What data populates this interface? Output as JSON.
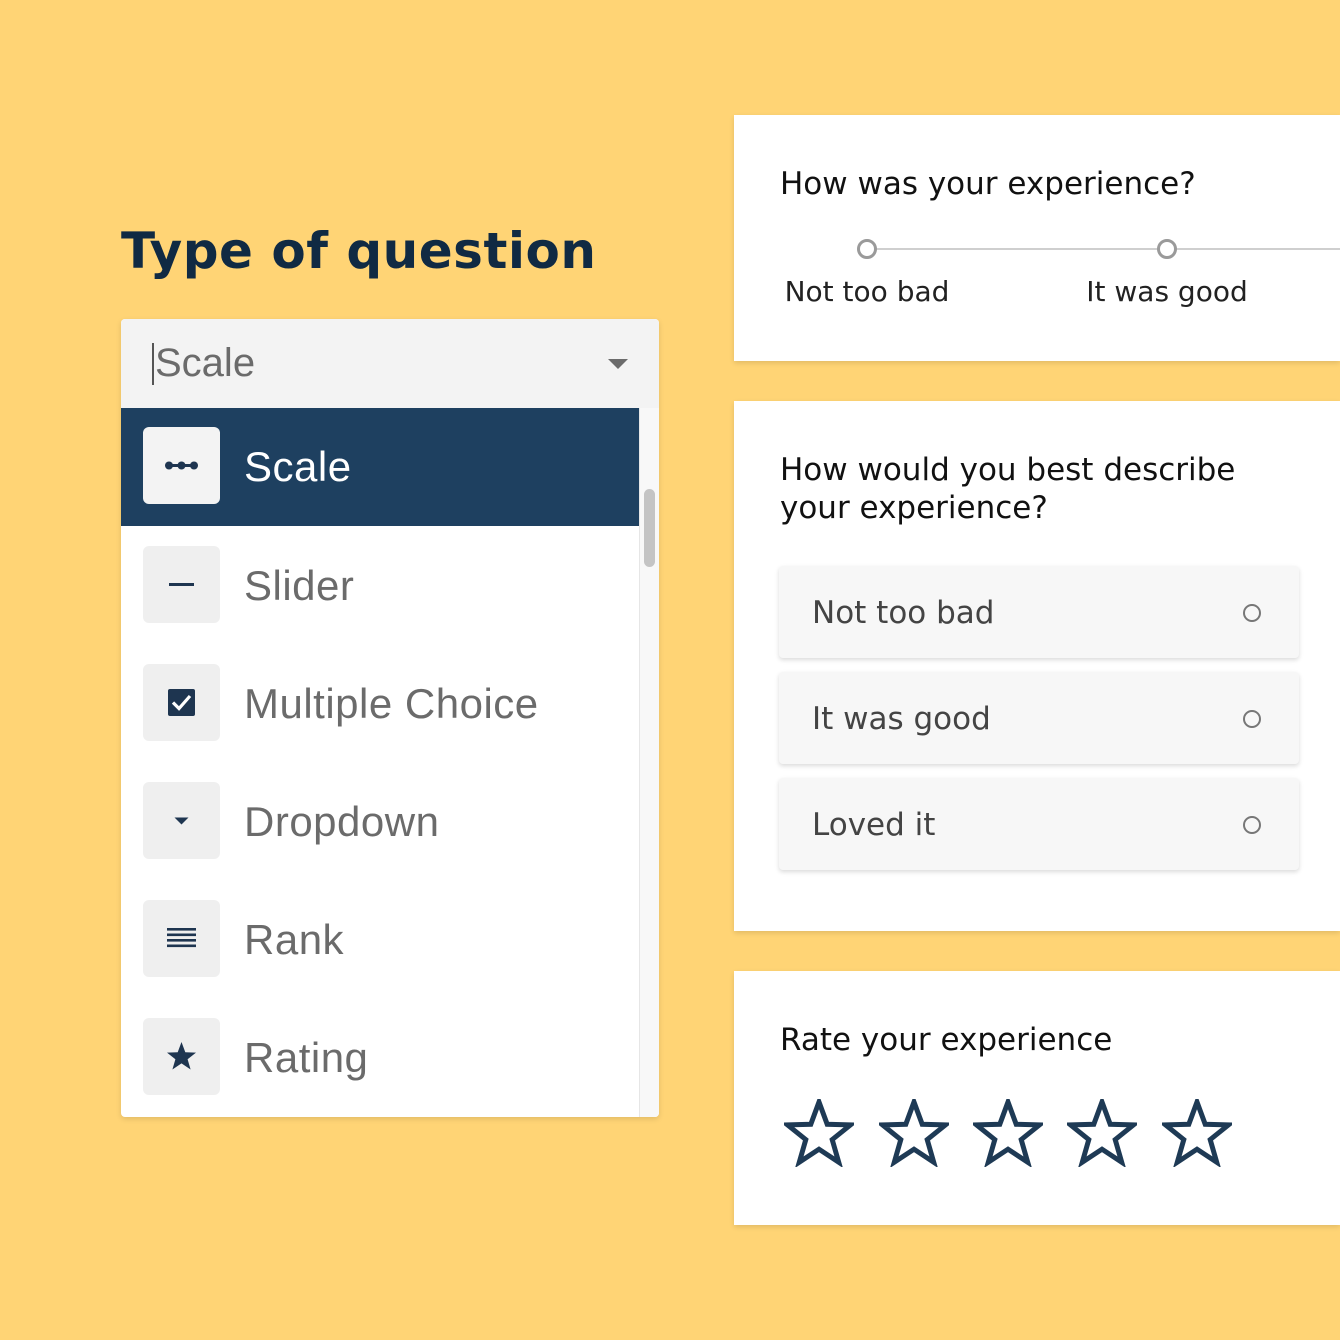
{
  "heading": "Type of question",
  "select": {
    "value": "Scale",
    "options": [
      {
        "label": "Scale",
        "icon": "scale-dots-icon",
        "selected": true
      },
      {
        "label": "Slider",
        "icon": "slider-dash-icon",
        "selected": false
      },
      {
        "label": "Multiple Choice",
        "icon": "checkbox-icon",
        "selected": false
      },
      {
        "label": "Dropdown",
        "icon": "dropdown-arrow-icon",
        "selected": false
      },
      {
        "label": "Rank",
        "icon": "rank-lines-icon",
        "selected": false
      },
      {
        "label": "Rating",
        "icon": "star-icon",
        "selected": false
      }
    ]
  },
  "scale_card": {
    "question": "How was your experience?",
    "labels": [
      "Not too bad",
      "It was good"
    ]
  },
  "choice_card": {
    "question_line1": "How would you best describe",
    "question_line2": "your experience?",
    "choices": [
      "Not too bad",
      "It was good",
      "Loved it"
    ]
  },
  "rating_card": {
    "question": "Rate your experience",
    "max_stars": 5,
    "filled_stars": 0
  },
  "colors": {
    "background": "#ffd475",
    "accent": "#1e4060",
    "heading": "#102a43"
  }
}
